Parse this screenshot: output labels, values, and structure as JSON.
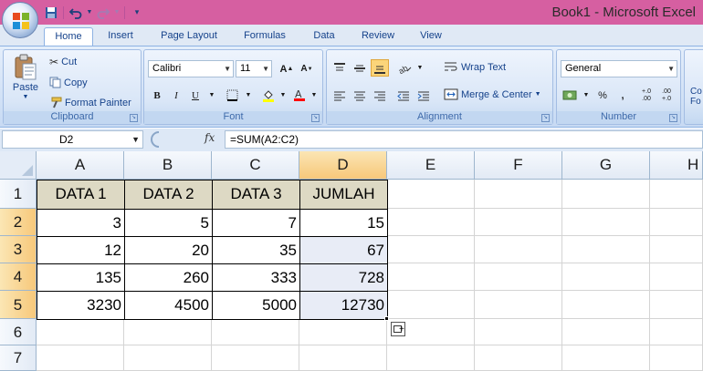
{
  "window": {
    "title": "Book1 - Microsoft Excel"
  },
  "quick_access": {
    "items": [
      "save-icon",
      "undo-icon",
      "redo-icon",
      "customize-icon"
    ]
  },
  "tabs": [
    {
      "label": "Home",
      "active": true
    },
    {
      "label": "Insert"
    },
    {
      "label": "Page Layout"
    },
    {
      "label": "Formulas"
    },
    {
      "label": "Data"
    },
    {
      "label": "Review"
    },
    {
      "label": "View"
    }
  ],
  "ribbon": {
    "clipboard": {
      "label": "Clipboard",
      "paste": "Paste",
      "cut": "Cut",
      "copy": "Copy",
      "format_painter": "Format Painter"
    },
    "font": {
      "label": "Font",
      "family": "Calibri",
      "size": "11",
      "bold": "B",
      "italic": "I",
      "underline": "U"
    },
    "alignment": {
      "label": "Alignment",
      "wrap_text": "Wrap Text",
      "merge_center": "Merge & Center"
    },
    "number": {
      "label": "Number",
      "format": "General",
      "percent": "%",
      "comma": ",",
      "inc_decimal": "+.0 .00",
      "dec_decimal": ".00 +.0"
    },
    "styles": {
      "conditional_formatting_partial": "Co Fo"
    }
  },
  "formula_bar": {
    "name_box": "D2",
    "fx": "fx",
    "formula": "=SUM(A2:C2)"
  },
  "grid": {
    "columns": [
      "A",
      "B",
      "C",
      "D",
      "E",
      "F",
      "G",
      "H"
    ],
    "rows": [
      "1",
      "2",
      "3",
      "4",
      "5",
      "6",
      "7"
    ],
    "selected_column": "D",
    "selected_rows": [
      "2",
      "3",
      "4",
      "5"
    ],
    "cells": {
      "header": [
        "DATA 1",
        "DATA 2",
        "DATA 3",
        "JUMLAH"
      ],
      "data": [
        [
          "3",
          "5",
          "7",
          "15"
        ],
        [
          "12",
          "20",
          "35",
          "67"
        ],
        [
          "135",
          "260",
          "333",
          "728"
        ],
        [
          "3230",
          "4500",
          "5000",
          "12730"
        ]
      ]
    }
  },
  "colors": {
    "title_bar": "#d65fa1",
    "ribbon": "#dbe6f5",
    "header_fill": "#ddd9c4",
    "selection_header": "#f7c87a"
  }
}
